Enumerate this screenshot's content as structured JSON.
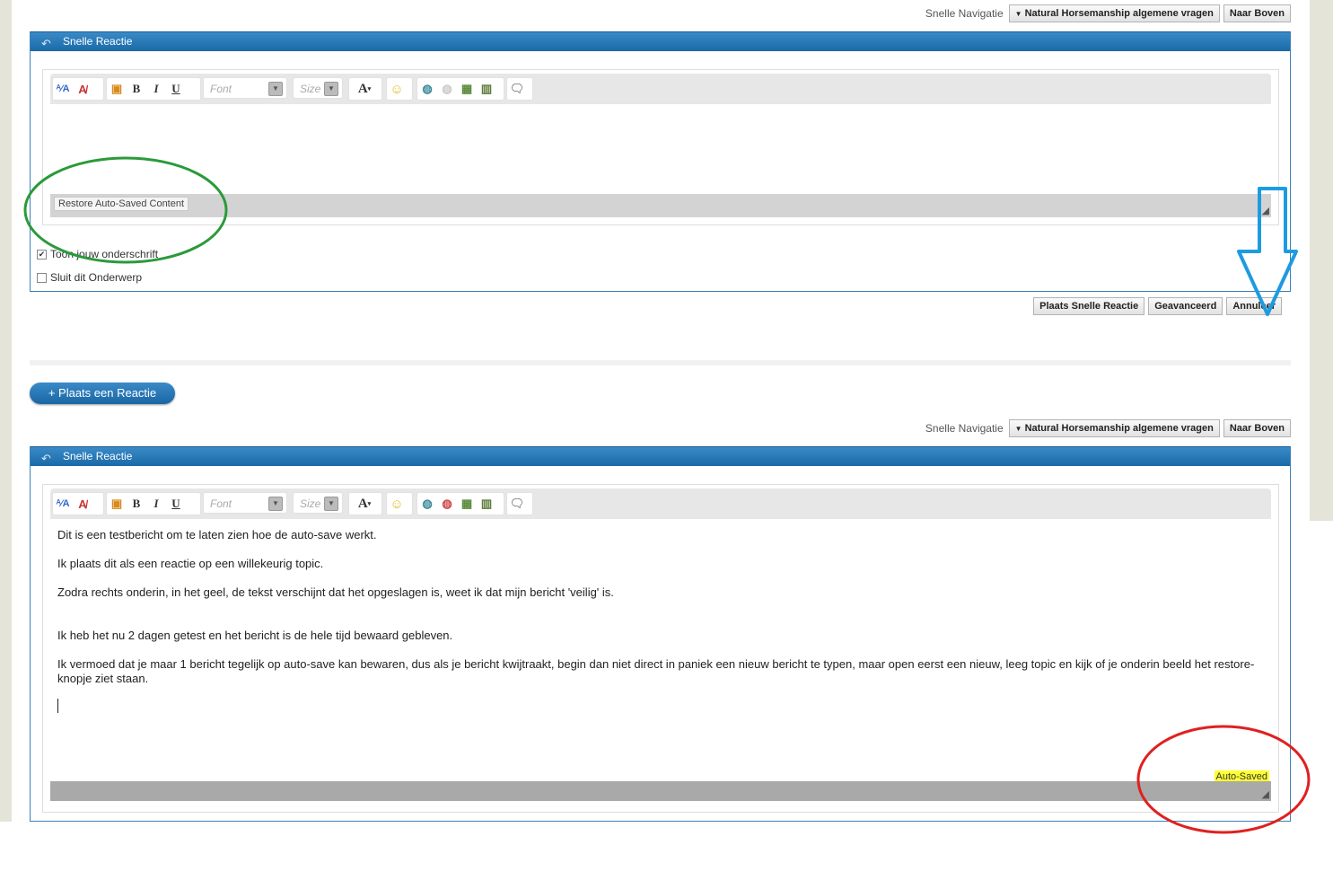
{
  "top_nav": {
    "label": "Snelle Navigatie",
    "forum": "Natural Horsemanship algemene vragen",
    "top_button": "Naar Boven"
  },
  "panel1": {
    "title": "Snelle Reactie",
    "toolbar": {
      "font": "Font",
      "size": "Size"
    },
    "restore": "Restore Auto-Saved Content",
    "checkboxes": [
      {
        "label": "Toon jouw onderschrift",
        "checked": true
      },
      {
        "label": "Sluit dit Onderwerp",
        "checked": false
      }
    ],
    "buttons": {
      "submit": "Plaats Snelle Reactie",
      "advanced": "Geavanceerd",
      "cancel": "Annuleer"
    }
  },
  "post_button": "+ Plaats een Reactie",
  "bottom_nav": {
    "label": "Snelle Navigatie",
    "forum": "Natural Horsemanship algemene vragen",
    "top_button": "Naar Boven"
  },
  "panel2": {
    "title": "Snelle Reactie",
    "toolbar": {
      "font": "Font",
      "size": "Size"
    },
    "auto_saved": "Auto-Saved",
    "message": [
      "Dit is een testbericht om te laten zien hoe de auto-save werkt.",
      "Ik plaats dit als een reactie op een willekeurig topic.",
      "Zodra rechts onderin, in het geel, de tekst verschijnt dat het opgeslagen is, weet ik dat mijn bericht 'veilig' is.",
      "Ik heb het nu 2 dagen getest en het bericht is de hele tijd bewaard gebleven.",
      "Ik vermoed dat je maar 1 bericht tegelijk op auto-save kan bewaren, dus als je bericht kwijtraakt, begin dan niet direct in paniek een nieuw bericht te typen, maar open eerst een nieuw, leeg topic en kijk of je onderin beeld het restore-knopje ziet staan."
    ]
  },
  "colors": {
    "panel_blue": "#1b6aa8",
    "highlight": "#ffff33",
    "green_circle": "#2a9a3a",
    "red_circle": "#e02020",
    "blue_arrow": "#1e9be0"
  }
}
